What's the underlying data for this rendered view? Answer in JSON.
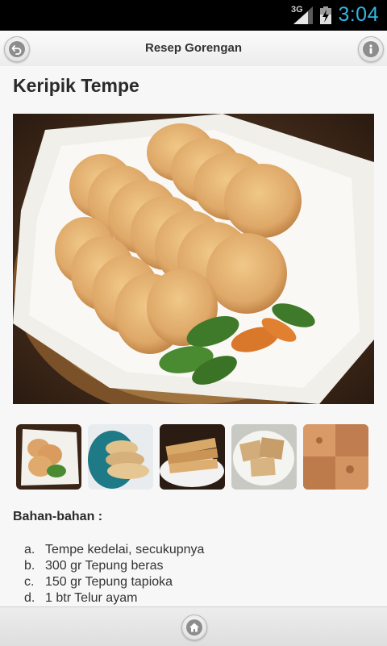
{
  "status_bar": {
    "network": "3G",
    "time": "3:04",
    "accent_color": "#33b5e5"
  },
  "action_bar": {
    "title": "Resep Gorengan",
    "back_icon": "back-arrow-icon",
    "info_icon": "info-icon"
  },
  "recipe": {
    "title": "Keripik Tempe",
    "hero_image": "keripik-tempe-photo",
    "thumbnails": [
      "keripik-tempe-on-paper",
      "keripik-tempe-blue-plate",
      "keripik-tempe-sliced-stack",
      "keripik-tempe-white-plate",
      "keripik-tempe-close-up"
    ],
    "ingredients_heading": "Bahan-bahan :",
    "ingredients": [
      {
        "marker": "a.",
        "text": "Tempe kedelai, secukupnya"
      },
      {
        "marker": "b.",
        "text": "300 gr Tepung beras"
      },
      {
        "marker": "c.",
        "text": "150 gr Tepung tapioka"
      },
      {
        "marker": "d.",
        "text": "1 btr Telur ayam"
      }
    ]
  },
  "bottom_bar": {
    "home_icon": "home-icon"
  }
}
